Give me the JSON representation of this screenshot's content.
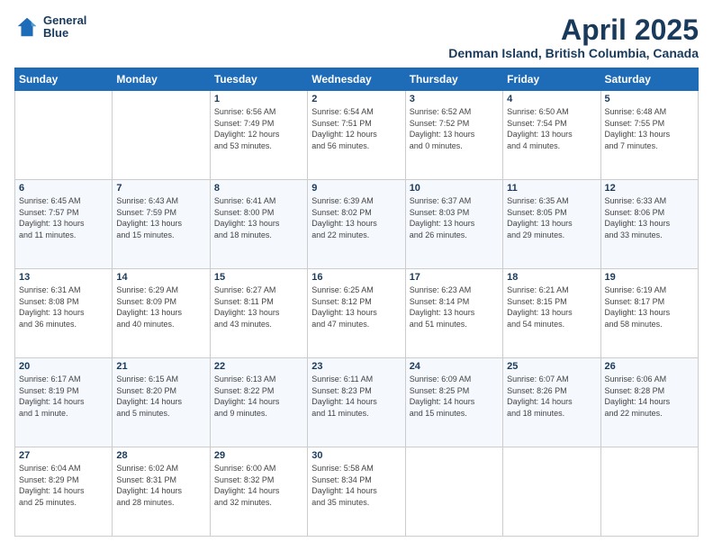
{
  "header": {
    "logo_line1": "General",
    "logo_line2": "Blue",
    "month_title": "April 2025",
    "location": "Denman Island, British Columbia, Canada"
  },
  "days_of_week": [
    "Sunday",
    "Monday",
    "Tuesday",
    "Wednesday",
    "Thursday",
    "Friday",
    "Saturday"
  ],
  "weeks": [
    [
      {
        "day": "",
        "info": ""
      },
      {
        "day": "",
        "info": ""
      },
      {
        "day": "1",
        "info": "Sunrise: 6:56 AM\nSunset: 7:49 PM\nDaylight: 12 hours\nand 53 minutes."
      },
      {
        "day": "2",
        "info": "Sunrise: 6:54 AM\nSunset: 7:51 PM\nDaylight: 12 hours\nand 56 minutes."
      },
      {
        "day": "3",
        "info": "Sunrise: 6:52 AM\nSunset: 7:52 PM\nDaylight: 13 hours\nand 0 minutes."
      },
      {
        "day": "4",
        "info": "Sunrise: 6:50 AM\nSunset: 7:54 PM\nDaylight: 13 hours\nand 4 minutes."
      },
      {
        "day": "5",
        "info": "Sunrise: 6:48 AM\nSunset: 7:55 PM\nDaylight: 13 hours\nand 7 minutes."
      }
    ],
    [
      {
        "day": "6",
        "info": "Sunrise: 6:45 AM\nSunset: 7:57 PM\nDaylight: 13 hours\nand 11 minutes."
      },
      {
        "day": "7",
        "info": "Sunrise: 6:43 AM\nSunset: 7:59 PM\nDaylight: 13 hours\nand 15 minutes."
      },
      {
        "day": "8",
        "info": "Sunrise: 6:41 AM\nSunset: 8:00 PM\nDaylight: 13 hours\nand 18 minutes."
      },
      {
        "day": "9",
        "info": "Sunrise: 6:39 AM\nSunset: 8:02 PM\nDaylight: 13 hours\nand 22 minutes."
      },
      {
        "day": "10",
        "info": "Sunrise: 6:37 AM\nSunset: 8:03 PM\nDaylight: 13 hours\nand 26 minutes."
      },
      {
        "day": "11",
        "info": "Sunrise: 6:35 AM\nSunset: 8:05 PM\nDaylight: 13 hours\nand 29 minutes."
      },
      {
        "day": "12",
        "info": "Sunrise: 6:33 AM\nSunset: 8:06 PM\nDaylight: 13 hours\nand 33 minutes."
      }
    ],
    [
      {
        "day": "13",
        "info": "Sunrise: 6:31 AM\nSunset: 8:08 PM\nDaylight: 13 hours\nand 36 minutes."
      },
      {
        "day": "14",
        "info": "Sunrise: 6:29 AM\nSunset: 8:09 PM\nDaylight: 13 hours\nand 40 minutes."
      },
      {
        "day": "15",
        "info": "Sunrise: 6:27 AM\nSunset: 8:11 PM\nDaylight: 13 hours\nand 43 minutes."
      },
      {
        "day": "16",
        "info": "Sunrise: 6:25 AM\nSunset: 8:12 PM\nDaylight: 13 hours\nand 47 minutes."
      },
      {
        "day": "17",
        "info": "Sunrise: 6:23 AM\nSunset: 8:14 PM\nDaylight: 13 hours\nand 51 minutes."
      },
      {
        "day": "18",
        "info": "Sunrise: 6:21 AM\nSunset: 8:15 PM\nDaylight: 13 hours\nand 54 minutes."
      },
      {
        "day": "19",
        "info": "Sunrise: 6:19 AM\nSunset: 8:17 PM\nDaylight: 13 hours\nand 58 minutes."
      }
    ],
    [
      {
        "day": "20",
        "info": "Sunrise: 6:17 AM\nSunset: 8:19 PM\nDaylight: 14 hours\nand 1 minute."
      },
      {
        "day": "21",
        "info": "Sunrise: 6:15 AM\nSunset: 8:20 PM\nDaylight: 14 hours\nand 5 minutes."
      },
      {
        "day": "22",
        "info": "Sunrise: 6:13 AM\nSunset: 8:22 PM\nDaylight: 14 hours\nand 9 minutes."
      },
      {
        "day": "23",
        "info": "Sunrise: 6:11 AM\nSunset: 8:23 PM\nDaylight: 14 hours\nand 11 minutes."
      },
      {
        "day": "24",
        "info": "Sunrise: 6:09 AM\nSunset: 8:25 PM\nDaylight: 14 hours\nand 15 minutes."
      },
      {
        "day": "25",
        "info": "Sunrise: 6:07 AM\nSunset: 8:26 PM\nDaylight: 14 hours\nand 18 minutes."
      },
      {
        "day": "26",
        "info": "Sunrise: 6:06 AM\nSunset: 8:28 PM\nDaylight: 14 hours\nand 22 minutes."
      }
    ],
    [
      {
        "day": "27",
        "info": "Sunrise: 6:04 AM\nSunset: 8:29 PM\nDaylight: 14 hours\nand 25 minutes."
      },
      {
        "day": "28",
        "info": "Sunrise: 6:02 AM\nSunset: 8:31 PM\nDaylight: 14 hours\nand 28 minutes."
      },
      {
        "day": "29",
        "info": "Sunrise: 6:00 AM\nSunset: 8:32 PM\nDaylight: 14 hours\nand 32 minutes."
      },
      {
        "day": "30",
        "info": "Sunrise: 5:58 AM\nSunset: 8:34 PM\nDaylight: 14 hours\nand 35 minutes."
      },
      {
        "day": "",
        "info": ""
      },
      {
        "day": "",
        "info": ""
      },
      {
        "day": "",
        "info": ""
      }
    ]
  ]
}
